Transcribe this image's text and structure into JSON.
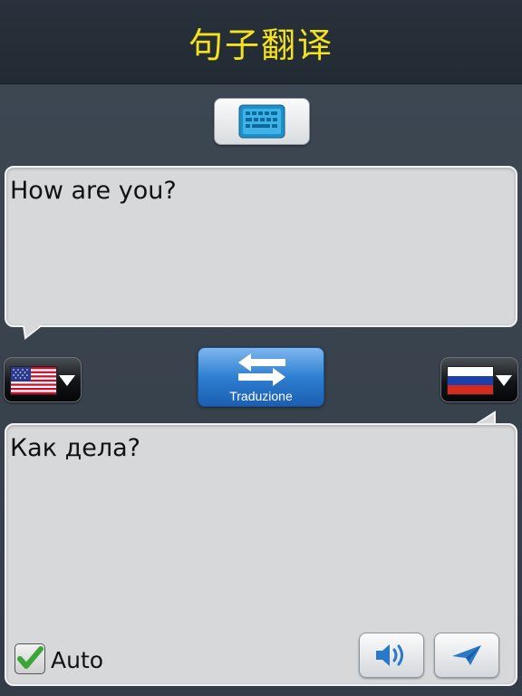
{
  "header": {
    "title": "句子翻译"
  },
  "source": {
    "text": "How are you?",
    "language_flag": "us-flag-icon"
  },
  "target": {
    "text": "Как дела?",
    "language_flag": "russia-flag-icon"
  },
  "translate_button": {
    "label": "Traduzione"
  },
  "auto": {
    "label": "Auto",
    "checked": true
  },
  "colors": {
    "title": "#f4e21c",
    "background": "#3b4550",
    "translate_button": "#2e7fd2",
    "check_green": "#3aa63a"
  },
  "icons": {
    "keyboard": "keyboard-icon",
    "swap": "swap-arrows-icon",
    "speak": "speaker-icon",
    "send": "send-icon",
    "dropdown": "triangle-down-icon"
  }
}
